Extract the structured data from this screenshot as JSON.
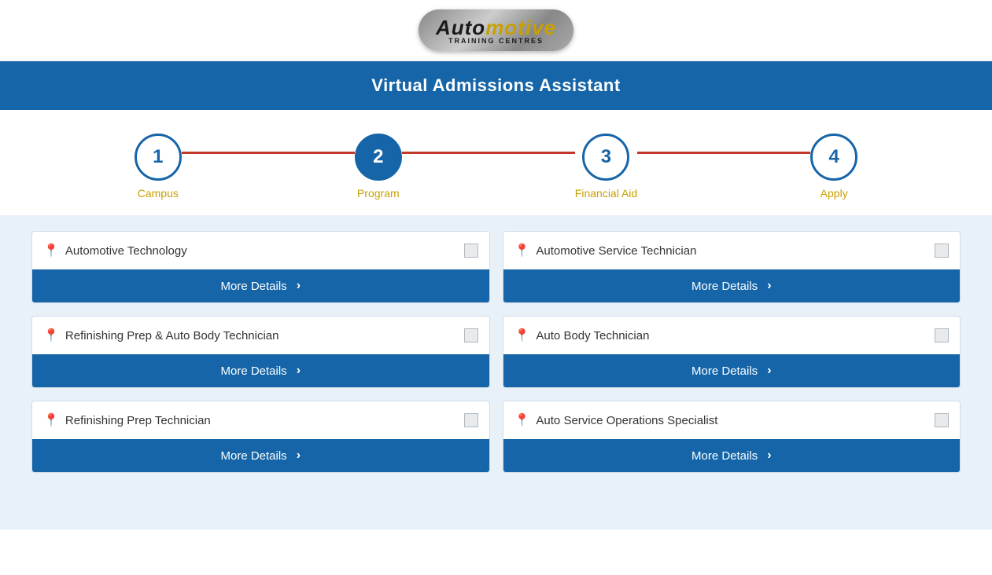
{
  "header": {
    "logo_text_auto": "Auto",
    "logo_text_motive": "motive",
    "logo_sub": "TRAINING CENTRES"
  },
  "banner": {
    "title": "Virtual Admissions Assistant"
  },
  "stepper": {
    "steps": [
      {
        "number": "1",
        "label": "Campus",
        "active": false
      },
      {
        "number": "2",
        "label": "Program",
        "active": true
      },
      {
        "number": "3",
        "label": "Financial Aid",
        "active": false
      },
      {
        "number": "4",
        "label": "Apply",
        "active": false
      }
    ]
  },
  "programs": {
    "more_details_label": "More Details",
    "chevron": "›",
    "items": [
      {
        "id": "automotive-technology",
        "name": "Automotive Technology",
        "col": "left"
      },
      {
        "id": "automotive-service-technician",
        "name": "Automotive Service Technician",
        "col": "right"
      },
      {
        "id": "refinishing-prep-auto-body",
        "name": "Refinishing Prep & Auto Body Technician",
        "col": "left"
      },
      {
        "id": "auto-body-technician",
        "name": "Auto Body Technician",
        "col": "right"
      },
      {
        "id": "refinishing-prep-technician",
        "name": "Refinishing Prep Technician",
        "col": "left"
      },
      {
        "id": "auto-service-operations-specialist",
        "name": "Auto Service Operations Specialist",
        "col": "right"
      }
    ]
  }
}
